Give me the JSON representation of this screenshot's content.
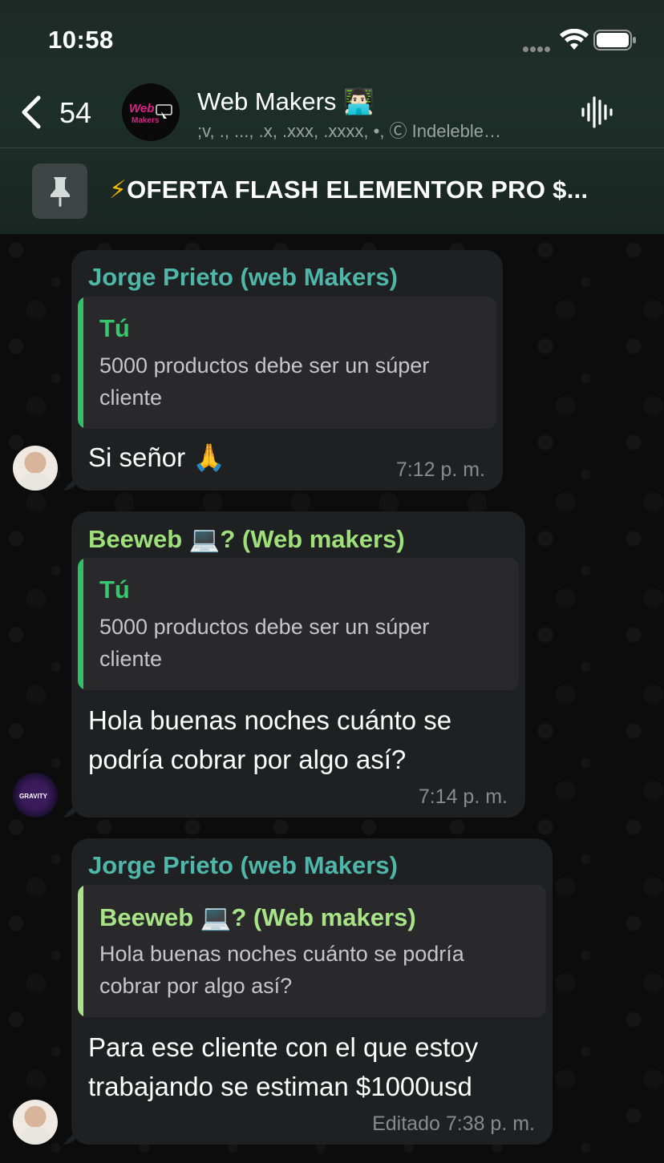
{
  "status_bar": {
    "time": "10:58"
  },
  "header": {
    "back_count": "54",
    "group_title": "Web Makers",
    "group_title_emoji": "👨🏻‍💻",
    "group_subtitle": ";v, ., ..., .x, .xxx, .xxxx, •, Ⓒ Indeleble…",
    "avatar_text_1": "Web",
    "avatar_text_2": "Makers"
  },
  "pinned": {
    "text": "OFERTA FLASH ELEMENTOR PRO $...",
    "emoji": "⚡"
  },
  "messages": [
    {
      "sender": "Jorge Prieto (web Makers)",
      "quote_author": "Tú",
      "quote_line1": "5000 productos debe ser un súper",
      "quote_line2": "cliente",
      "text": "Si señor 🙏",
      "time": "7:12 p. m."
    },
    {
      "sender": "Beeweb 💻? (Web makers)",
      "quote_author": "Tú",
      "quote_line1": "5000 productos debe ser un súper",
      "quote_line2": "cliente",
      "text_line1": "Hola buenas noches cuánto se",
      "text_line2": "podría cobrar por algo así?",
      "time": "7:14 p. m.",
      "avatar_label": "GRAVITY"
    },
    {
      "sender": "Jorge Prieto (web Makers)",
      "quote_author": "Beeweb 💻? (Web makers)",
      "quote_line1": "Hola buenas noches cuánto se podría",
      "quote_line2": "cobrar por algo así?",
      "text_line1": "Para ese cliente con el que estoy",
      "text_line2": "trabajando se estiman $1000usd",
      "time": "Editado 7:38 p. m."
    }
  ]
}
